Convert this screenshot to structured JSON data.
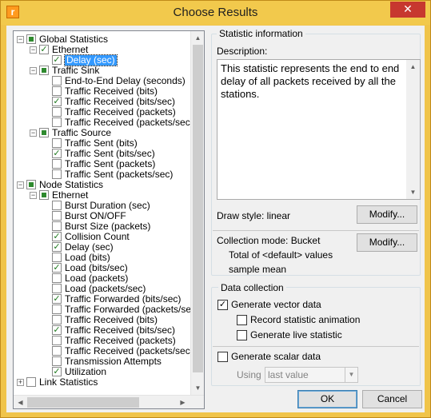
{
  "window": {
    "title": "Choose Results",
    "icon_letter": "r"
  },
  "tree": {
    "rows": [
      {
        "label": "Global Statistics",
        "level": 0,
        "exp": "-",
        "check": "partial"
      },
      {
        "label": "Ethernet",
        "level": 1,
        "exp": "-",
        "check": "checked"
      },
      {
        "label": "Delay (sec)",
        "level": 2,
        "check": "checked",
        "selected": true
      },
      {
        "label": "Traffic Sink",
        "level": 1,
        "exp": "-",
        "check": "partial"
      },
      {
        "label": "End-to-End Delay (seconds)",
        "level": 2,
        "check": "none"
      },
      {
        "label": "Traffic Received (bits)",
        "level": 2,
        "check": "none"
      },
      {
        "label": "Traffic Received (bits/sec)",
        "level": 2,
        "check": "checked"
      },
      {
        "label": "Traffic Received (packets)",
        "level": 2,
        "check": "none"
      },
      {
        "label": "Traffic Received (packets/sec)",
        "level": 2,
        "check": "none"
      },
      {
        "label": "Traffic Source",
        "level": 1,
        "exp": "-",
        "check": "partial"
      },
      {
        "label": "Traffic Sent (bits)",
        "level": 2,
        "check": "none"
      },
      {
        "label": "Traffic Sent (bits/sec)",
        "level": 2,
        "check": "checked"
      },
      {
        "label": "Traffic Sent (packets)",
        "level": 2,
        "check": "none"
      },
      {
        "label": "Traffic Sent (packets/sec)",
        "level": 2,
        "check": "none"
      },
      {
        "label": "Node Statistics",
        "level": 0,
        "exp": "-",
        "check": "partial"
      },
      {
        "label": "Ethernet",
        "level": 1,
        "exp": "-",
        "check": "partial"
      },
      {
        "label": "Burst Duration (sec)",
        "level": 2,
        "check": "none"
      },
      {
        "label": "Burst ON/OFF",
        "level": 2,
        "check": "none"
      },
      {
        "label": "Burst Size (packets)",
        "level": 2,
        "check": "none"
      },
      {
        "label": "Collision Count",
        "level": 2,
        "check": "checked"
      },
      {
        "label": "Delay (sec)",
        "level": 2,
        "check": "checked"
      },
      {
        "label": "Load (bits)",
        "level": 2,
        "check": "none"
      },
      {
        "label": "Load (bits/sec)",
        "level": 2,
        "check": "checked"
      },
      {
        "label": "Load (packets)",
        "level": 2,
        "check": "none"
      },
      {
        "label": "Load (packets/sec)",
        "level": 2,
        "check": "none"
      },
      {
        "label": "Traffic Forwarded (bits/sec)",
        "level": 2,
        "check": "checked"
      },
      {
        "label": "Traffic Forwarded (packets/sec)",
        "level": 2,
        "check": "none"
      },
      {
        "label": "Traffic Received (bits)",
        "level": 2,
        "check": "none"
      },
      {
        "label": "Traffic Received (bits/sec)",
        "level": 2,
        "check": "checked"
      },
      {
        "label": "Traffic Received (packets)",
        "level": 2,
        "check": "none"
      },
      {
        "label": "Traffic Received (packets/sec)",
        "level": 2,
        "check": "none"
      },
      {
        "label": "Transmission Attempts",
        "level": 2,
        "check": "none"
      },
      {
        "label": "Utilization",
        "level": 2,
        "check": "checked"
      },
      {
        "label": "Link Statistics",
        "level": 0,
        "exp": "+",
        "check": "none"
      }
    ]
  },
  "stat_info": {
    "group_title": "Statistic information",
    "description_label": "Description:",
    "description": "This statistic represents the end to end delay of all packets received by all the stations.",
    "draw_style": "Draw style: linear",
    "modify_label": "Modify...",
    "collection_mode": "Collection mode: Bucket",
    "collection_detail_1": "Total of <default> values",
    "collection_detail_2": "sample mean",
    "modify2_label": "Modify..."
  },
  "data_collection": {
    "group_title": "Data collection",
    "generate_vector": "Generate vector data",
    "generate_vector_checked": true,
    "record_animation": "Record statistic animation",
    "generate_live": "Generate live statistic",
    "generate_scalar": "Generate scalar data",
    "using_label": "Using",
    "using_value": "last value"
  },
  "buttons": {
    "ok": "OK",
    "cancel": "Cancel"
  }
}
